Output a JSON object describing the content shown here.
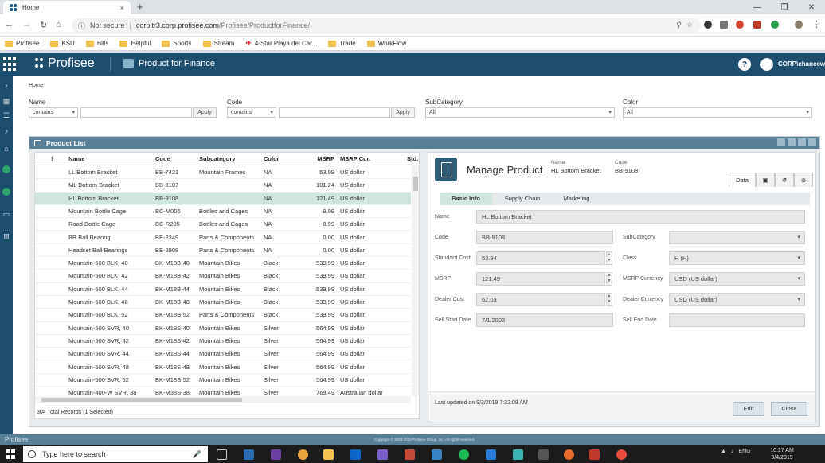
{
  "browser": {
    "tab_title": "Home",
    "tab_close": "×",
    "new_tab": "+",
    "not_secure": "Not secure",
    "url_host": "corpltr3.corp.profisee.com",
    "url_path": "/Profisee/ProductforFinance/",
    "bookmarks": [
      "Profisee",
      "KSU",
      "Bills",
      "Helpful",
      "Sports",
      "Stream",
      "4-Star Playa del Car...",
      "Trade",
      "WorkFlow"
    ]
  },
  "app": {
    "brand": "Profisee",
    "app_name": "Product for Finance",
    "help": "?",
    "user": "CORP\\chancewi"
  },
  "breadcrumb": "Home",
  "filters": {
    "name_label": "Name",
    "name_op": "contains",
    "name_apply": "Apply",
    "code_label": "Code",
    "code_op": "contains",
    "code_apply": "Apply",
    "subcategory_label": "SubCategory",
    "subcategory_value": "All",
    "color_label": "Color",
    "color_value": "All"
  },
  "product_list": {
    "title": "Product List",
    "columns": {
      "flag": "!",
      "name": "Name",
      "code": "Code",
      "subcategory": "Subcategory",
      "color": "Color",
      "msrp": "MSRP",
      "currency": "MSRP Cur.",
      "std": "Std."
    },
    "rows": [
      {
        "name": "LL Bottom Bracket",
        "code": "BB-7421",
        "subcategory": "Mountain Frames",
        "color": "NA",
        "msrp": "53.99",
        "currency": "US dollar"
      },
      {
        "name": "ML Bottom Bracket",
        "code": "BB-8107",
        "subcategory": "",
        "color": "NA",
        "msrp": "101.24",
        "currency": "US dollar"
      },
      {
        "name": "HL Bottom Bracket",
        "code": "BB-9108",
        "subcategory": "",
        "color": "NA",
        "msrp": "121.49",
        "currency": "US dollar"
      },
      {
        "name": "Mountain Bottle Cage",
        "code": "BC-M005",
        "subcategory": "Bottles and Cages",
        "color": "NA",
        "msrp": "9.99",
        "currency": "US dollar"
      },
      {
        "name": "Road Bottle Cage",
        "code": "BC-R205",
        "subcategory": "Bottles and Cages",
        "color": "NA",
        "msrp": "8.99",
        "currency": "US dollar"
      },
      {
        "name": "BB Ball Bearing",
        "code": "BE-2349",
        "subcategory": "Parts & Components",
        "color": "NA",
        "msrp": "0.00",
        "currency": "US dollar"
      },
      {
        "name": "Headset Ball Bearings",
        "code": "BE-2908",
        "subcategory": "Parts & Components",
        "color": "NA",
        "msrp": "0.00",
        "currency": "US dollar"
      },
      {
        "name": "Mountain-500 BLK, 40",
        "code": "BK-M18B-40",
        "subcategory": "Mountain Bikes",
        "color": "Black",
        "msrp": "539.99",
        "currency": "US dollar"
      },
      {
        "name": "Mountain-500 BLK, 42",
        "code": "BK-M18B-42",
        "subcategory": "Mountain Bikes",
        "color": "Black",
        "msrp": "539.99",
        "currency": "US dollar"
      },
      {
        "name": "Mountain-500 BLK, 44",
        "code": "BK-M18B-44",
        "subcategory": "Mountain Bikes",
        "color": "Black",
        "msrp": "539.99",
        "currency": "US dollar"
      },
      {
        "name": "Mountain-500 BLK, 48",
        "code": "BK-M18B-48",
        "subcategory": "Mountain Bikes",
        "color": "Black",
        "msrp": "539.99",
        "currency": "US dollar"
      },
      {
        "name": "Mountain-500 BLK, 52",
        "code": "BK-M18B-52",
        "subcategory": "Parts & Components",
        "color": "Black",
        "msrp": "539.99",
        "currency": "US dollar"
      },
      {
        "name": "Mountain-500 SVR, 40",
        "code": "BK-M18S-40",
        "subcategory": "Mountain Bikes",
        "color": "Silver",
        "msrp": "564.99",
        "currency": "US dollar"
      },
      {
        "name": "Mountain-500 SVR, 42",
        "code": "BK-M18S-42",
        "subcategory": "Mountain Bikes",
        "color": "Silver",
        "msrp": "564.99",
        "currency": "US dollar"
      },
      {
        "name": "Mountain-500 SVR, 44",
        "code": "BK-M18S-44",
        "subcategory": "Mountain Bikes",
        "color": "Silver",
        "msrp": "564.99",
        "currency": "US dollar"
      },
      {
        "name": "Mountain-500 SVR, 48",
        "code": "BK-M18S-48",
        "subcategory": "Mountain Bikes",
        "color": "Silver",
        "msrp": "564.99",
        "currency": "US dollar"
      },
      {
        "name": "Mountain-500 SVR, 52",
        "code": "BK-M18S-52",
        "subcategory": "Mountain Bikes",
        "color": "Silver",
        "msrp": "564.99",
        "currency": "US dollar"
      },
      {
        "name": "Mountain-400-W SVR, 38",
        "code": "BK-M38S-38",
        "subcategory": "Mountain Bikes",
        "color": "Silver",
        "msrp": "769.49",
        "currency": "Australian dollar"
      }
    ],
    "selected_index": 2,
    "total_records": "304 Total Records (1 Selected)"
  },
  "manage_product": {
    "title": "Manage Product",
    "name_label": "Name",
    "name_value": "HL Bottom Bracket",
    "code_label": "Code",
    "code_value": "BB-9108",
    "side_tabs": {
      "data": "Data"
    },
    "subtabs": [
      "Basic Info",
      "Supply Chain",
      "Marketing"
    ],
    "fields": {
      "name": {
        "label": "Name",
        "value": "HL Bottom Bracket"
      },
      "code": {
        "label": "Code",
        "value": "BB-9108"
      },
      "subcategory": {
        "label": "SubCategory",
        "value": ""
      },
      "standard_cost": {
        "label": "Standard Cost",
        "value": "53.94"
      },
      "class": {
        "label": "Class",
        "value": "H (H)"
      },
      "msrp": {
        "label": "MSRP",
        "value": "121.49"
      },
      "msrp_currency": {
        "label": "MSRP Currency",
        "value": "USD (US dollar)"
      },
      "dealer_cost": {
        "label": "Dealer Cost",
        "value": "62.03"
      },
      "dealer_currency": {
        "label": "Dealer Currency",
        "value": "USD (US dollar)"
      },
      "sell_start_date": {
        "label": "Sell Start Date",
        "value": "7/1/2003"
      },
      "sell_end_date": {
        "label": "Sell End Date",
        "value": ""
      }
    },
    "last_updated": "Last updated on 9/3/2019 7:32:09 AM",
    "edit_label": "Edit",
    "close_label": "Close"
  },
  "footer": {
    "brand": "Profisee",
    "copyright": "Copyright © 2003-2019 Profisee Group, Inc. All rights reserved."
  },
  "taskbar": {
    "search_placeholder": "Type here to search",
    "lang": "ENG",
    "time": "10:17 AM",
    "date": "9/4/2019"
  }
}
